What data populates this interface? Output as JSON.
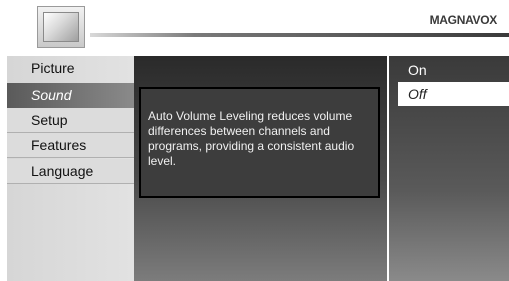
{
  "header": {
    "brand": "MAGNAVOX",
    "icon": "tv-icon"
  },
  "menu": {
    "items": [
      {
        "label": "Picture",
        "selected": false
      },
      {
        "label": "Sound",
        "selected": true
      },
      {
        "label": "Setup",
        "selected": false
      },
      {
        "label": "Features",
        "selected": false
      },
      {
        "label": "Language",
        "selected": false
      }
    ]
  },
  "info": {
    "text": "Auto Volume Leveling reduces volume differences between channels and programs, providing a consistent audio level."
  },
  "options": {
    "items": [
      {
        "label": "On",
        "highlighted": false
      },
      {
        "label": "Off",
        "highlighted": true
      }
    ]
  }
}
